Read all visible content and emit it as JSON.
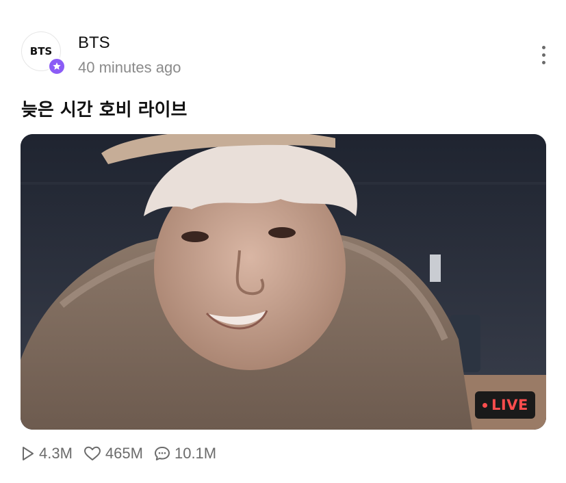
{
  "post": {
    "author": {
      "name": "BTS",
      "avatar_text": "BTS",
      "timestamp": "40 minutes ago",
      "verified_icon": "star-badge-icon"
    },
    "title": "늦은 시간 호비 라이브",
    "video": {
      "status_badge": "LIVE",
      "thumbnail": "live-broadcast-thumbnail"
    },
    "stats": {
      "plays": "4.3M",
      "likes": "465M",
      "comments": "10.1M"
    },
    "menu_icon": "more-vertical-icon"
  },
  "colors": {
    "accent": "#8b5cf6",
    "live_text": "#ff4d4d",
    "live_bg": "#1a1a1a",
    "meta_text": "#8a8a8a"
  }
}
